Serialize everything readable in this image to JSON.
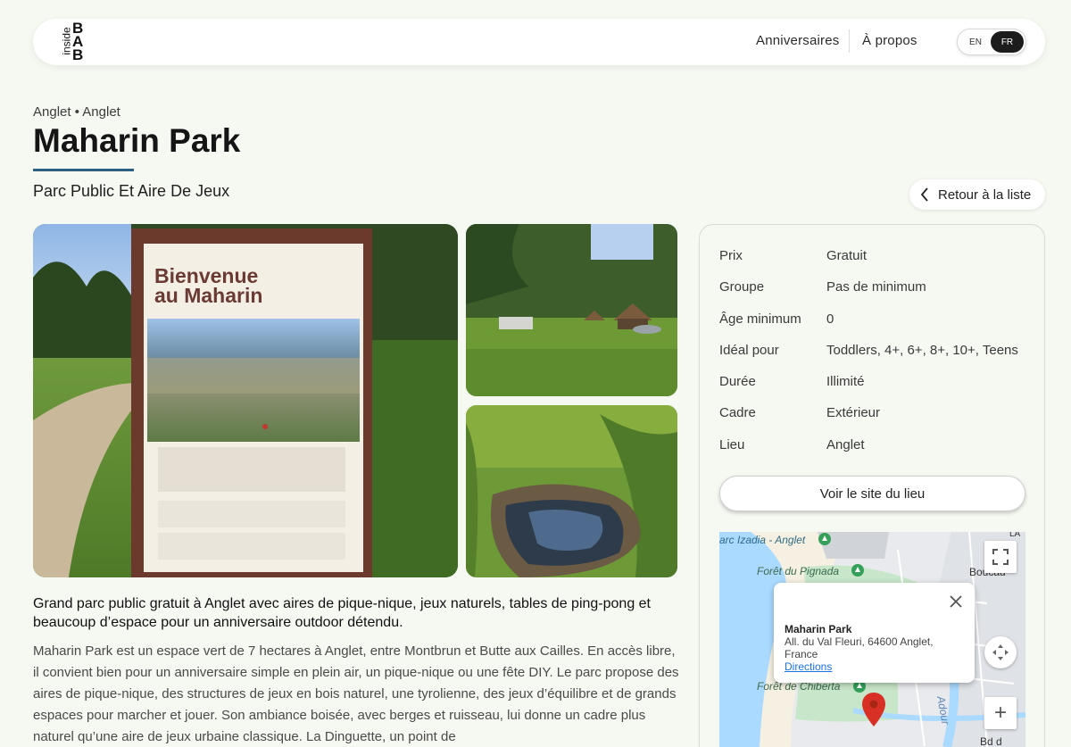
{
  "header": {
    "logo": {
      "small": "inside",
      "letters": [
        "B",
        "A",
        "B"
      ]
    },
    "nav": [
      {
        "label": "Anniversaires"
      },
      {
        "label": "À propos"
      }
    ],
    "lang": {
      "en": "EN",
      "fr": "FR",
      "active": "FR"
    }
  },
  "page": {
    "breadcrumb": "Anglet • Anglet",
    "title": "Maharin Park",
    "subtitle": "Parc Public Et Aire De Jeux",
    "back_label": "Retour à la liste",
    "accent_color": "#2b5e82"
  },
  "gallery": {
    "sign_title_line1": "Bienvenue",
    "sign_title_line2": "au Maharin"
  },
  "description": {
    "lead": "Grand parc public gratuit à Anglet avec aires de pique-nique, jeux naturels, tables de ping-pong et beaucoup d’espace pour un anniversaire outdoor détendu.",
    "body": "Maharin Park est un espace vert de 7 hectares à Anglet, entre Montbrun et Butte aux Cailles. En accès libre, il convient bien pour un anniversaire simple en plein air, un pique-nique ou une fête DIY. Le parc propose des aires de pique-nique, des structures de jeux en bois naturel, une tyrolienne, des jeux d’équilibre et de grands espaces pour marcher et jouer. Son ambiance boisée, avec berges et ruisseau, lui donne un cadre plus naturel qu’une aire de jeux urbaine classique. La Dinguette, un point de"
  },
  "info": {
    "rows": [
      {
        "label": "Prix",
        "value": "Gratuit"
      },
      {
        "label": "Groupe",
        "value": "Pas de minimum"
      },
      {
        "label": "Âge minimum",
        "value": "0"
      },
      {
        "label": "Idéal pour",
        "value": "Toddlers, 4+, 6+, 8+, 10+, Teens"
      },
      {
        "label": "Durée",
        "value": "Illimité"
      },
      {
        "label": "Cadre",
        "value": "Extérieur"
      },
      {
        "label": "Lieu",
        "value": "Anglet"
      }
    ],
    "site_button": "Voir le site du lieu"
  },
  "map": {
    "labels": {
      "izadia": "arc Izadia - Anglet",
      "pignada": "Forêt du Pignada",
      "chiberta": "Forêt de Chiberta",
      "boucau": "Boucau",
      "adour": "Adour",
      "bd": "Bd d",
      "la": "LA"
    },
    "popup": {
      "title": "Maharin Park",
      "address": "All. du Val Fleuri, 64600 Anglet, France",
      "directions": "Directions"
    },
    "zoom_in": "+"
  }
}
